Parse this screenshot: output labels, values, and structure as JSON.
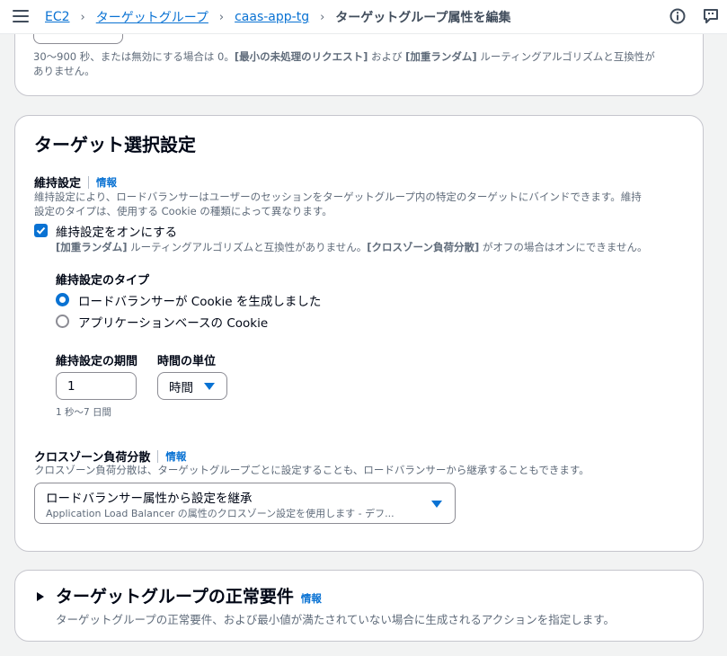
{
  "breadcrumb": {
    "items": [
      "EC2",
      "ターゲットグループ",
      "caas-app-tg"
    ],
    "separator": "›",
    "current": "ターゲットグループ属性を編集"
  },
  "icons": {
    "menu": "hamburger-icon",
    "info": "info-circle-icon",
    "notifications": "feedback-icon"
  },
  "prev_section": {
    "help_prefix": "30〜900 秒、または無効にする場合は 0。",
    "help_bold1": "[最小の未処理のリクエスト]",
    "help_mid": " および ",
    "help_bold2": "[加重ランダム]",
    "help_suffix": " ルーティングアルゴリズムと互換性が",
    "help_line2": "ありません。"
  },
  "target_selection": {
    "title": "ターゲット選択設定",
    "stickiness": {
      "label": "維持設定",
      "info": "情報",
      "description_line1": "維持設定により、ロードバランサーはユーザーのセッションをターゲットグループ内の特定のターゲットにバインドできます。維持",
      "description_line2": "設定のタイプは、使用する Cookie の種類によって異なります。",
      "checkbox_label": "維持設定をオンにする",
      "checkbox_checked": true,
      "note_bold1": "[加重ランダム]",
      "note_mid": " ルーティングアルゴリズムと互換性がありません。",
      "note_bold2": "[クロスゾーン負荷分散]",
      "note_suffix": " がオフの場合はオンにできません。",
      "type_label": "維持設定のタイプ",
      "type_options": [
        "ロードバランサーが Cookie を生成しました",
        "アプリケーションベースの Cookie"
      ],
      "type_selected_index": 0,
      "duration_label": "維持設定の期間",
      "duration_value": "1",
      "unit_label": "時間の単位",
      "unit_value": "時間",
      "duration_hint": "1 秒〜7 日間"
    },
    "cross_zone": {
      "label": "クロスゾーン負荷分散",
      "info": "情報",
      "description": "クロスゾーン負荷分散は、ターゲットグループごとに設定することも、ロードバランサーから継承することもできます。",
      "select_value": "ロードバランサー属性から設定を継承",
      "select_subtext": "Application Load Balancer の属性のクロスゾーン設定を使用します - デフ..."
    }
  },
  "health_requirements": {
    "title": "ターゲットグループの正常要件",
    "info": "情報",
    "description": "ターゲットグループの正常要件、および最小値が満たされていない場合に生成されるアクションを指定します。",
    "expanded": false
  },
  "colors": {
    "link": "#0972d3",
    "text": "#000716",
    "muted": "#5f6b7a",
    "border": "#c6c6cd",
    "background": "#f2f3f3"
  }
}
